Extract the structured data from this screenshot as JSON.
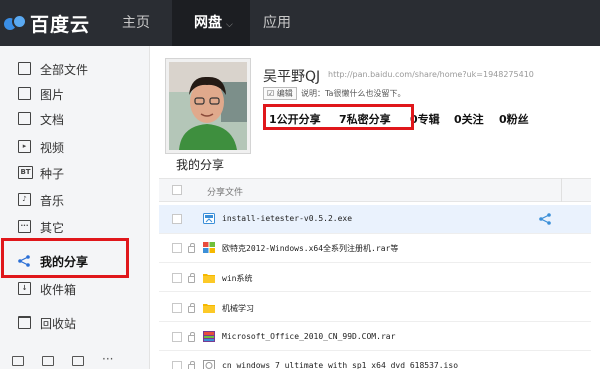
{
  "topnav": {
    "logo_text": "百度云",
    "home_label": "主页",
    "disk_label": "网盘",
    "apps_label": "应用"
  },
  "sidebar": {
    "items": [
      {
        "label": "全部文件",
        "icon": "all-files-icon"
      },
      {
        "label": "图片",
        "icon": "image-icon"
      },
      {
        "label": "文档",
        "icon": "document-icon"
      },
      {
        "label": "视频",
        "icon": "video-icon"
      },
      {
        "label": "种子",
        "icon": "bt-torrent-icon"
      },
      {
        "label": "音乐",
        "icon": "music-icon"
      },
      {
        "label": "其它",
        "icon": "other-icon"
      },
      {
        "label": "我的分享",
        "icon": "share-icon"
      },
      {
        "label": "收件箱",
        "icon": "inbox-icon"
      },
      {
        "label": "回收站",
        "icon": "trash-icon"
      }
    ],
    "bottom_icons": [
      "windows-icon",
      "android-icon",
      "mobile-icon",
      "more-icon"
    ]
  },
  "profile": {
    "name": "吴平野QJ",
    "url": "http://pan.baidu.com/share/home?uk=1948275410",
    "edit_label": "编辑",
    "description": "说明：Ta很懒什么也没留下。",
    "stats": [
      {
        "value": "1",
        "label": "公开分享"
      },
      {
        "value": "7",
        "label": "私密分享"
      },
      {
        "value": "0",
        "label": "专辑"
      },
      {
        "value": "0",
        "label": "关注"
      },
      {
        "value": "0",
        "label": "粉丝"
      }
    ]
  },
  "shares": {
    "title": "我的分享",
    "column_header": "分享文件",
    "files": [
      {
        "name": "install-ietester-v0.5.2.exe",
        "icon": "exe-file-icon"
      },
      {
        "name": "欧特克2012-Windows.x64全系列注册机.rar等",
        "icon": "windows-app-icon"
      },
      {
        "name": "win系统",
        "icon": "folder-icon"
      },
      {
        "name": "机械学习",
        "icon": "folder-icon"
      },
      {
        "name": "Microsoft_Office_2010_CN_99D.COM.rar",
        "icon": "rar-file-icon"
      },
      {
        "name": "cn_windows_7_ultimate_with_sp1_x64_dvd_618537.iso",
        "icon": "iso-file-icon"
      }
    ]
  },
  "colors": {
    "topbar": "#2a2d33",
    "highlight": "#e0171b",
    "selected_row": "#eaf2fd",
    "folder": "#f5b800"
  }
}
